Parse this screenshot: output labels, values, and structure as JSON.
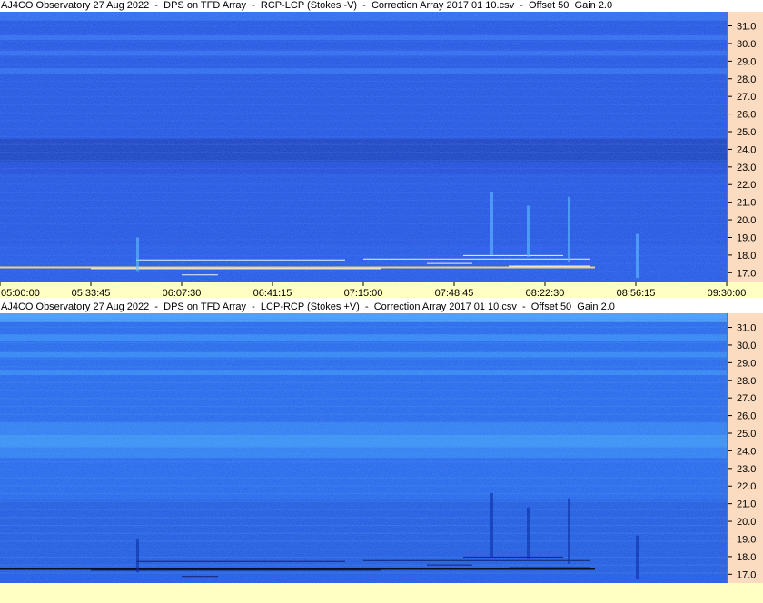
{
  "chart_data": [
    {
      "type": "heatmap",
      "title": "AJ4CO Observatory 27 Aug 2022  -  DPS on TFD Array  -  RCP-LCP (Stokes -V)  -  Correction Array 2017 01 10.csv  -  Offset 50  Gain 2.0",
      "y_ticks": [
        "31.0",
        "30.0",
        "29.0",
        "28.0",
        "27.0",
        "26.0",
        "25.0",
        "24.0",
        "23.0",
        "22.0",
        "21.0",
        "20.0",
        "19.0",
        "18.0",
        "17.0"
      ],
      "ylim": [
        16.5,
        31.8
      ],
      "x_ticks": [
        "05:00:00",
        "05:33:45",
        "06:07:30",
        "06:41:15",
        "07:15:00",
        "07:48:45",
        "08:22:30",
        "08:56:15",
        "09:30:00"
      ],
      "colors": {
        "base": "#1c4fe0",
        "dark_band": "#1238b8",
        "bright_band": "#2c6af0"
      }
    },
    {
      "type": "heatmap",
      "title": "AJ4CO Observatory 27 Aug 2022  -  DPS on TFD Array  -  LCP-RCP (Stokes +V)  -  Correction Array 2017 01 10.csv  -  Offset 50  Gain 2.0",
      "y_ticks": [
        "31.0",
        "30.0",
        "29.0",
        "28.0",
        "27.0",
        "26.0",
        "25.0",
        "24.0",
        "23.0",
        "22.0",
        "21.0",
        "20.0",
        "19.0",
        "18.0",
        "17.0"
      ],
      "ylim": [
        16.5,
        31.8
      ],
      "colors": {
        "base": "#1f63ea",
        "dark_band": "#164bd0",
        "bright_band": "#2f86f4"
      }
    }
  ]
}
